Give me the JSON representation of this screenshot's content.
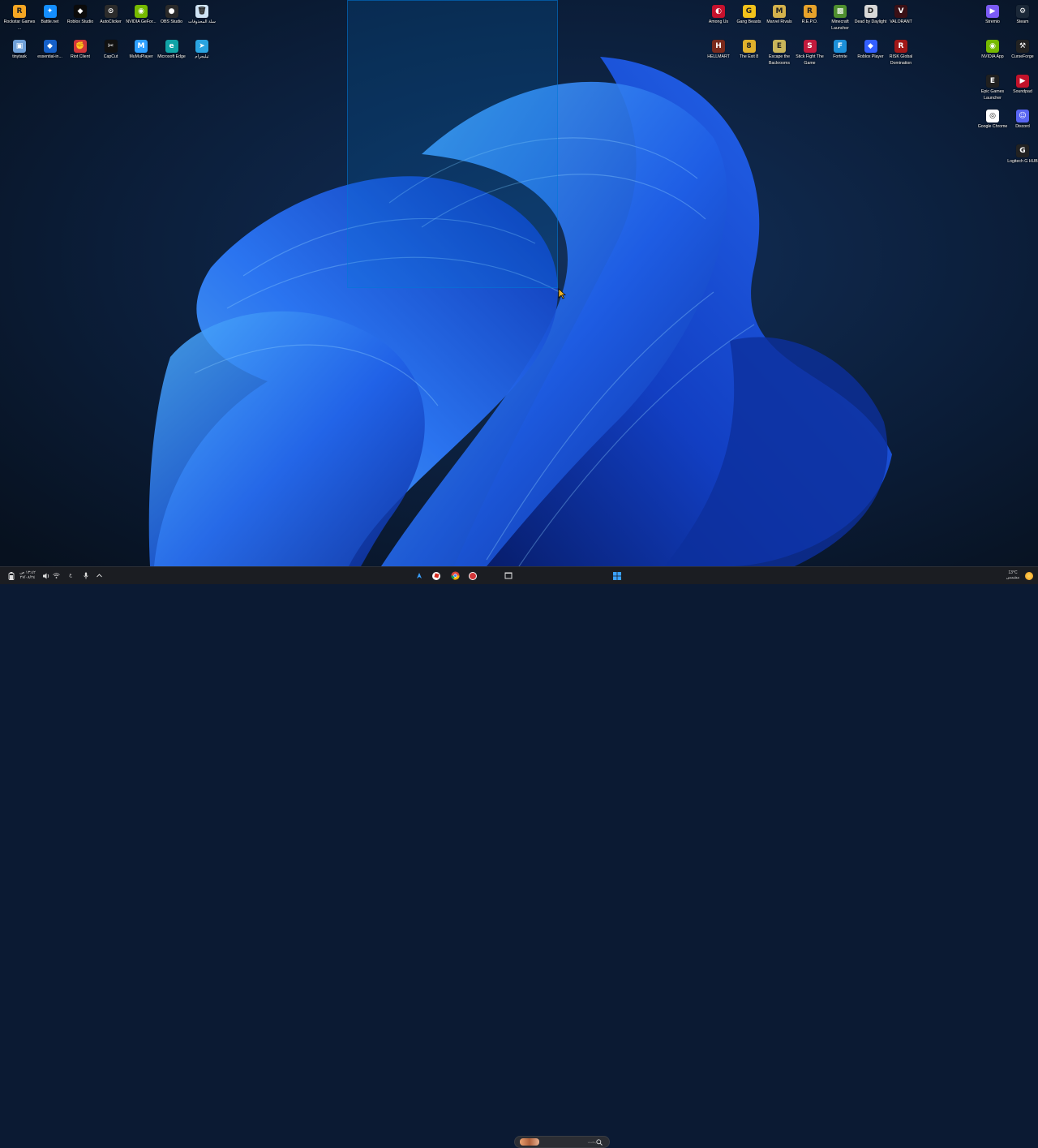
{
  "desktop": {
    "icons_top_left": [
      {
        "label": "Rockstar Games ...",
        "icon": "rockstar-icon",
        "color": "#f5a623",
        "glyph": "R"
      },
      {
        "label": "Battle.net",
        "icon": "battlenet-icon",
        "color": "#148eff",
        "glyph": "✦"
      },
      {
        "label": "Roblox Studio",
        "icon": "roblox-studio-icon",
        "color": "#0b0b0b",
        "glyph": "◆"
      },
      {
        "label": "AutoClicker",
        "icon": "autoclicker-icon",
        "color": "#2b2b2b",
        "glyph": "⊙"
      },
      {
        "label": "NVIDIA GeFor...",
        "icon": "nvidia-icon",
        "color": "#76b900",
        "glyph": "◉"
      },
      {
        "label": "OBS Studio",
        "icon": "obs-icon",
        "color": "#2a2a2a",
        "glyph": "●"
      },
      {
        "label": "سلة المحذوفات",
        "icon": "recycle-bin-icon",
        "color": "#cfe3f5",
        "glyph": "🗑"
      },
      {
        "label": "tinytask",
        "icon": "tinytask-icon",
        "color": "#6fa0d8",
        "glyph": "▣"
      },
      {
        "label": "essential-in...",
        "icon": "essential-icon",
        "color": "#1560c8",
        "glyph": "◆"
      },
      {
        "label": "Riot Client",
        "icon": "riot-client-icon",
        "color": "#d13639",
        "glyph": "✊"
      },
      {
        "label": "CapCut",
        "icon": "capcut-icon",
        "color": "#111111",
        "glyph": "✂"
      },
      {
        "label": "MuMuPlayer",
        "icon": "mumuplayer-icon",
        "color": "#2e9fff",
        "glyph": "M"
      },
      {
        "label": "Microsoft Edge",
        "icon": "edge-icon",
        "color": "#11a3a6",
        "glyph": "e"
      },
      {
        "label": "تيليجرام",
        "icon": "telegram-icon",
        "color": "#2aa3e0",
        "glyph": "➤"
      }
    ],
    "icons_top_right": [
      {
        "label": "Among Us",
        "icon": "among-us-icon",
        "color": "#c5112d",
        "glyph": "◐"
      },
      {
        "label": "Gang Beasts",
        "icon": "gang-beasts-icon",
        "color": "#f2c21b",
        "glyph": "G"
      },
      {
        "label": "Marvel Rivals",
        "icon": "marvel-rivals-icon",
        "color": "#d4b24c",
        "glyph": "M"
      },
      {
        "label": "R.E.P.O.",
        "icon": "repo-icon",
        "color": "#e8a32b",
        "glyph": "R"
      },
      {
        "label": "Minecraft Launcher",
        "icon": "minecraft-icon",
        "color": "#4f8f2f",
        "glyph": "▩"
      },
      {
        "label": "Dead by Daylight",
        "icon": "dead-by-daylight-icon",
        "color": "#d8d8d8",
        "glyph": "D"
      },
      {
        "label": "VALORANT",
        "icon": "valorant-icon",
        "color": "#3a1016",
        "glyph": "V"
      },
      {
        "label": "HELLMART",
        "icon": "hellmart-icon",
        "color": "#7a2a1c",
        "glyph": "H"
      },
      {
        "label": "The Exit 8",
        "icon": "exit8-icon",
        "color": "#e1b12c",
        "glyph": "8"
      },
      {
        "label": "Escape the Backrooms",
        "icon": "escape-backrooms-icon",
        "color": "#c9b55a",
        "glyph": "E"
      },
      {
        "label": "Stick Fight The Game",
        "icon": "stick-fight-icon",
        "color": "#c21a3d",
        "glyph": "S"
      },
      {
        "label": "Fortnite",
        "icon": "fortnite-icon",
        "color": "#1c8fd8",
        "glyph": "F"
      },
      {
        "label": "Roblox Player",
        "icon": "roblox-player-icon",
        "color": "#335fff",
        "glyph": "◆"
      },
      {
        "label": "RISK Global Domination",
        "icon": "risk-icon",
        "color": "#a01818",
        "glyph": "R"
      }
    ],
    "icons_far_right": [
      {
        "label": "Stremio",
        "icon": "stremio-icon",
        "color": "#7b5bf5",
        "glyph": "▶"
      },
      {
        "label": "Steam",
        "icon": "steam-icon",
        "color": "#1b2838",
        "glyph": "⚙"
      },
      {
        "label": "NVIDIA App",
        "icon": "nvidia-app-icon",
        "color": "#76b900",
        "glyph": "◉"
      },
      {
        "label": "CurseForge",
        "icon": "curseforge-icon",
        "color": "#222222",
        "glyph": "⚒"
      },
      {
        "label": "Epic Games Launcher",
        "icon": "epic-games-icon",
        "color": "#202020",
        "glyph": "E"
      },
      {
        "label": "Soundpad",
        "icon": "soundpad-icon",
        "color": "#c2122a",
        "glyph": "▶"
      },
      {
        "label": "Google Chrome",
        "icon": "chrome-icon",
        "color": "#ffffff",
        "glyph": "◎"
      },
      {
        "label": "Discord",
        "icon": "discord-icon",
        "color": "#5865f2",
        "glyph": "☺"
      },
      {
        "label": "Logitech G HUB",
        "icon": "logitech-ghub-icon",
        "color": "#222222",
        "glyph": "G"
      }
    ]
  },
  "taskbar": {
    "search_placeholder": "بحث",
    "clock_time": "١٣:٤٢ ص",
    "clock_date": "٢٧/٠٨/٢٤",
    "weather_temp": "13°C",
    "weather_desc": "مشمس",
    "language": "ع",
    "colors": {
      "bar": "#1b1d22",
      "accent": "#3aa0ff"
    }
  }
}
